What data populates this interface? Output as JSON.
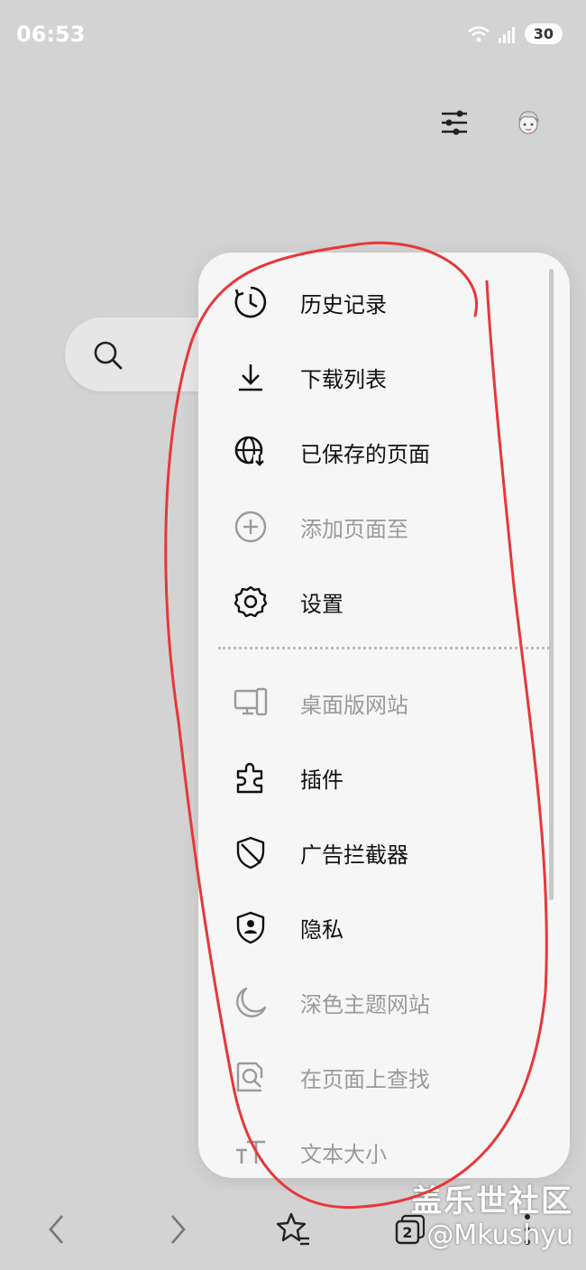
{
  "status_bar": {
    "time": "06:53",
    "battery": "30"
  },
  "menu": {
    "items": [
      {
        "label": "历史记录",
        "icon": "history-icon",
        "enabled": true
      },
      {
        "label": "下载列表",
        "icon": "download-icon",
        "enabled": true
      },
      {
        "label": "已保存的页面",
        "icon": "saved-pages-icon",
        "enabled": true
      },
      {
        "label": "添加页面至",
        "icon": "add-circle-icon",
        "enabled": false
      },
      {
        "label": "设置",
        "icon": "gear-icon",
        "enabled": true
      },
      {
        "label": "桌面版网站",
        "icon": "desktop-icon",
        "enabled": false
      },
      {
        "label": "插件",
        "icon": "puzzle-icon",
        "enabled": true
      },
      {
        "label": "广告拦截器",
        "icon": "shield-slash-icon",
        "enabled": true
      },
      {
        "label": "隐私",
        "icon": "privacy-shield-icon",
        "enabled": true
      },
      {
        "label": "深色主题网站",
        "icon": "moon-icon",
        "enabled": false
      },
      {
        "label": "在页面上查找",
        "icon": "find-in-page-icon",
        "enabled": false
      },
      {
        "label": "文本大小",
        "icon": "text-size-icon",
        "enabled": false
      }
    ]
  },
  "bottom_bar": {
    "tabs_count": "2"
  },
  "watermark": {
    "site": "盖乐世社区",
    "user": "@Mkushyu"
  },
  "colors": {
    "annotation": "#e8373a",
    "background": "#d3d3d3",
    "menu_bg": "#f6f6f6"
  }
}
